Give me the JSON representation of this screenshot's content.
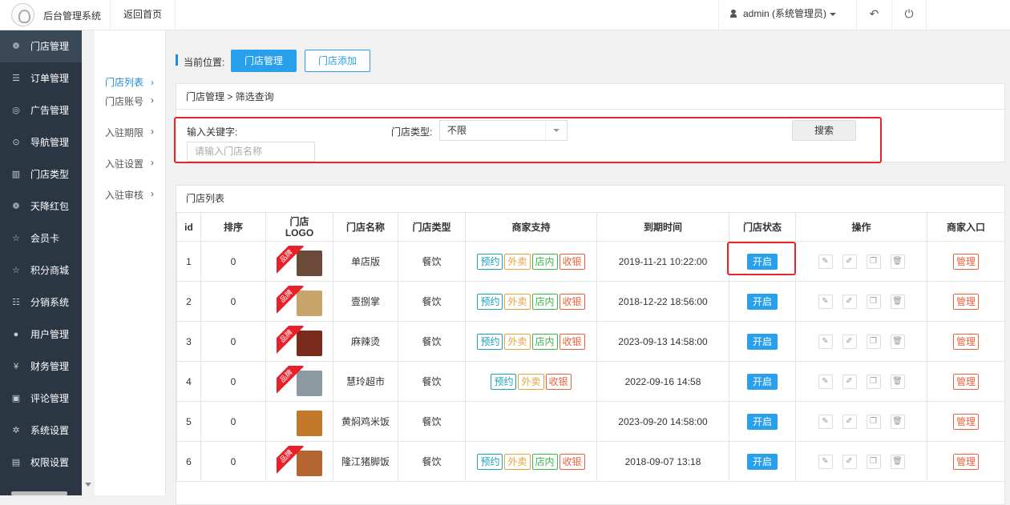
{
  "topbar": {
    "system_title": "后台管理系统",
    "back_home": "返回首页",
    "admin_label": "admin (系统管理员)",
    "undo_icon": "↶",
    "power_icon": "⏻"
  },
  "sidebar": {
    "items": [
      {
        "label": "门店管理",
        "icon": "❁",
        "active": true
      },
      {
        "label": "订单管理",
        "icon": "☰"
      },
      {
        "label": "广告管理",
        "icon": "◎"
      },
      {
        "label": "导航管理",
        "icon": "⊙"
      },
      {
        "label": "门店类型",
        "icon": "▥"
      },
      {
        "label": "天降红包",
        "icon": "❁"
      },
      {
        "label": "会员卡",
        "icon": "☆"
      },
      {
        "label": "积分商城",
        "icon": "☆"
      },
      {
        "label": "分销系统",
        "icon": "☷"
      },
      {
        "label": "用户管理",
        "icon": "●"
      },
      {
        "label": "财务管理",
        "icon": "¥"
      },
      {
        "label": "评论管理",
        "icon": "▣"
      },
      {
        "label": "系统设置",
        "icon": "✲"
      },
      {
        "label": "权限设置",
        "icon": "▤"
      }
    ]
  },
  "subnav": {
    "items": [
      {
        "label": "门店列表",
        "active": true
      },
      {
        "label": "门店账号"
      },
      {
        "label": "入驻期限"
      },
      {
        "label": "入驻设置"
      },
      {
        "label": "入驻审核"
      }
    ],
    "chevron": "›"
  },
  "location": {
    "label": "当前位置:",
    "primary_button": "门店管理",
    "secondary_button": "门店添加"
  },
  "filter": {
    "title": "门店管理 > 筛选查询",
    "keyword_label": "输入关键字:",
    "keyword_placeholder": "请输入门店名称",
    "type_label": "门店类型:",
    "type_value": "不限",
    "search_button": "搜索"
  },
  "list": {
    "title": "门店列表",
    "columns": [
      "id",
      "排序",
      "门店\nLOGO",
      "门店名称",
      "门店类型",
      "商家支持",
      "到期时间",
      "门店状态",
      "操作",
      "商家入口"
    ],
    "ribbon_text": "品牌",
    "tag_labels": {
      "book": "预约",
      "take": "外卖",
      "dine": "店内",
      "pay": "收银"
    },
    "status_label": "开启",
    "manage_label": "管理",
    "op_icons": [
      "pencil-icon",
      "edit-icon",
      "copy-icon",
      "trash-icon"
    ],
    "rows": [
      {
        "id": "1",
        "sort": "0",
        "name": "单店版",
        "type": "餐饮",
        "tags": [
          "book",
          "take",
          "dine",
          "pay"
        ],
        "expire": "2019-11-21 10:22:00",
        "ribbon": true,
        "thumb": "#6b4a3a"
      },
      {
        "id": "2",
        "sort": "0",
        "name": "壹捌掌",
        "type": "餐饮",
        "tags": [
          "book",
          "take",
          "dine",
          "pay"
        ],
        "expire": "2018-12-22 18:56:00",
        "ribbon": true,
        "thumb": "#c9a46a"
      },
      {
        "id": "3",
        "sort": "0",
        "name": "麻辣烫",
        "type": "餐饮",
        "tags": [
          "book",
          "take",
          "dine",
          "pay"
        ],
        "expire": "2023-09-13 14:58:00",
        "ribbon": true,
        "thumb": "#7a2b1e"
      },
      {
        "id": "4",
        "sort": "0",
        "name": "慧玲超市",
        "type": "餐饮",
        "tags": [
          "book",
          "take",
          "pay"
        ],
        "expire": "2022-09-16 14:58",
        "ribbon": true,
        "thumb": "#8a9aa0"
      },
      {
        "id": "5",
        "sort": "0",
        "name": "黄焖鸡米饭",
        "type": "餐饮",
        "tags": [],
        "expire": "2023-09-20 14:58:00",
        "ribbon": false,
        "thumb": "#c27a2a"
      },
      {
        "id": "6",
        "sort": "0",
        "name": "隆江猪脚饭",
        "type": "餐饮",
        "tags": [
          "book",
          "take",
          "dine",
          "pay"
        ],
        "expire": "2018-09-07 13:18",
        "ribbon": true,
        "thumb": "#b5652f"
      }
    ]
  },
  "colors": {
    "accent": "#29a0eb",
    "sidebar_bg": "#2b3643",
    "highlight": "#e4262a"
  }
}
